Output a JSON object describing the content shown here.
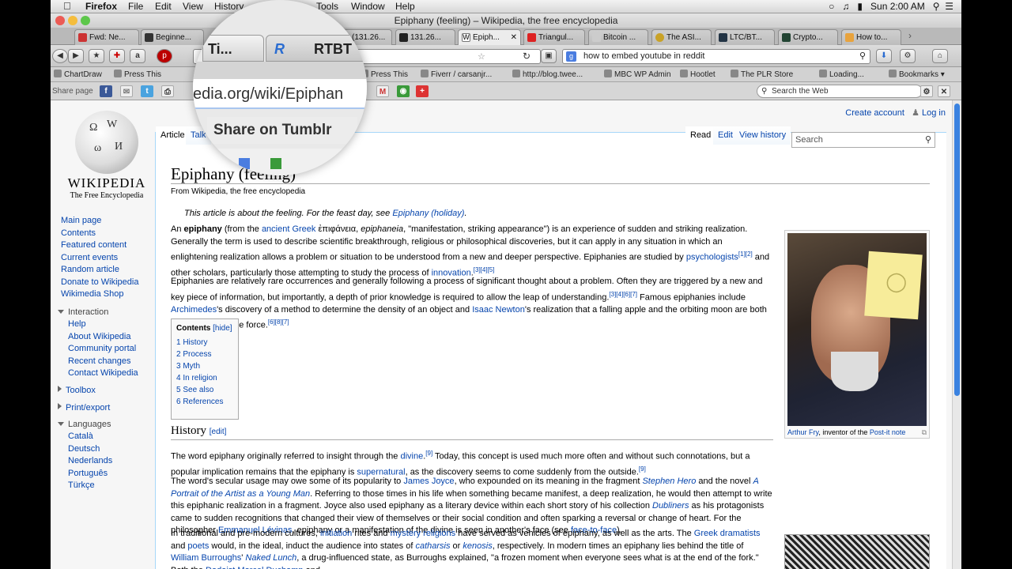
{
  "menubar": {
    "app": "Firefox",
    "items": [
      "File",
      "Edit",
      "View",
      "History",
      "Tools",
      "Window",
      "Help"
    ],
    "clock": "Sun 2:00 AM"
  },
  "window": {
    "title": "Epiphany (feeling) – Wikipedia, the free encyclopedia"
  },
  "tabs": [
    "Fwd: Ne...",
    "Beginne...",
    "(131.26...",
    "131.26...",
    "Epiph...",
    "Triangul...",
    "Bitcoin ...",
    "The ASI...",
    "LTC/BT...",
    "Crypto...",
    "How to..."
  ],
  "navbar": {
    "search_value": "how to embed youtube in reddit"
  },
  "bookmarks": [
    "ChartDraw",
    "Press This",
    "Press This",
    "Fiverr / carsanjr...",
    "http://blog.twee...",
    "MBC WP Admin",
    "Hootlet",
    "The PLR Store",
    "Loading...",
    "Bookmarks"
  ],
  "sharebar": {
    "label": "Share page",
    "web_search_placeholder": "Search the Web"
  },
  "magnifier": {
    "tab1": "Ti...",
    "tab2": "RTBT",
    "url": "edia.org/wiki/Epiphan",
    "tooltip": "Share on Tumblr"
  },
  "wiki": {
    "logo_wordmark": "WIKIPEDIA",
    "logo_tagline": "The Free Encyclopedia",
    "create_account": "Create account",
    "login": "Log in",
    "tab_article": "Article",
    "tab_talk": "Talk",
    "tab_read": "Read",
    "tab_edit": "Edit",
    "tab_history": "View history",
    "search_placeholder": "Search",
    "nav": [
      "Main page",
      "Contents",
      "Featured content",
      "Current events",
      "Random article",
      "Donate to Wikipedia",
      "Wikimedia Shop"
    ],
    "interaction_header": "Interaction",
    "interaction": [
      "Help",
      "About Wikipedia",
      "Community portal",
      "Recent changes",
      "Contact Wikipedia"
    ],
    "toolbox": "Toolbox",
    "printexport": "Print/export",
    "languages_header": "Languages",
    "languages": [
      "Català",
      "Deutsch",
      "Nederlands",
      "Português",
      "Türkçe"
    ],
    "title": "Epiphany (feeling)",
    "from": "From Wikipedia, the free encyclopedia",
    "hatnote_pre": "This article is about the feeling. For the feast day, see ",
    "hatnote_link": "Epiphany (holiday)",
    "hatnote_post": ".",
    "toc_title": "Contents",
    "toc_hide": "[hide]",
    "toc": [
      "1 History",
      "2 Process",
      "3 Myth",
      "4 In religion",
      "5 See also",
      "6 References"
    ],
    "history_heading": "History",
    "history_edit": "[edit]",
    "caption_link1": "Arthur Fry",
    "caption_text": ", inventor of the ",
    "caption_link2": "Post-it note"
  }
}
